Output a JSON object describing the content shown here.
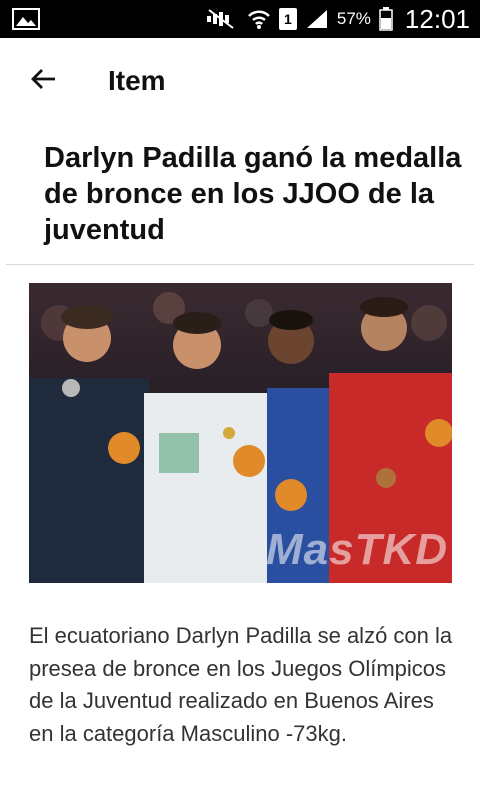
{
  "status_bar": {
    "battery_percent": "57%",
    "time": "12:01",
    "sim_slot": "1",
    "icons": [
      "image-notification-icon",
      "mute-icon",
      "wifi-icon",
      "sim-icon",
      "signal-icon",
      "battery-icon"
    ]
  },
  "app_bar": {
    "title": "Item",
    "back_icon": "arrow-left-icon"
  },
  "article": {
    "headline": "Darlyn Padilla ganó la medalla de bronce en los JJOO de la juventud",
    "image_watermark": "MasTKD",
    "body": "El ecuatoriano Darlyn Padilla se alzó con la presea de bronce en los Juegos Olímpicos de la Juventud realizado en Buenos Aires en la categoría Masculino -73kg."
  },
  "colors": {
    "status_bar_bg": "#000000",
    "background": "#ffffff",
    "headline": "#111111",
    "body_text": "#333333",
    "divider": "#d9d9d9"
  }
}
